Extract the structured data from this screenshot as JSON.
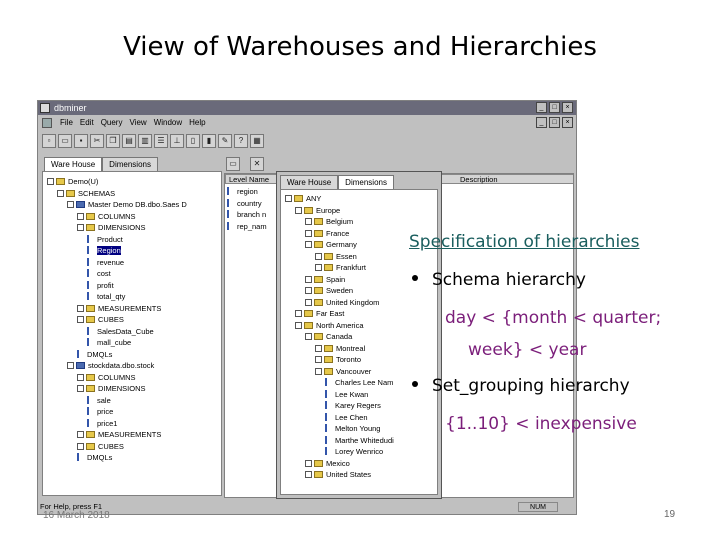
{
  "slide": {
    "title": "View of Warehouses and Hierarchies",
    "date": "16 March 2018",
    "page_number": "19"
  },
  "app": {
    "title": "dbminer",
    "menus": [
      "File",
      "Edit",
      "Query",
      "View",
      "Window",
      "Help"
    ],
    "status": "For Help, press F1",
    "num_indicator": "NUM"
  },
  "left_panel": {
    "tabs": [
      "Ware House",
      "Dimensions"
    ],
    "tree": [
      {
        "label": "Demo(U)",
        "kind": "folder",
        "level": 0
      },
      {
        "label": "SCHEMAS",
        "kind": "folder",
        "level": 1
      },
      {
        "label": "Master Demo DB.dbo.Saes D",
        "kind": "dim",
        "level": 2
      },
      {
        "label": "COLUMNS",
        "kind": "folder",
        "level": 3
      },
      {
        "label": "DIMENSIONS",
        "kind": "folder",
        "level": 3
      },
      {
        "label": "Product",
        "kind": "item",
        "level": 4
      },
      {
        "label": "Region",
        "kind": "item",
        "level": 4,
        "selected": true
      },
      {
        "label": "revenue",
        "kind": "item",
        "level": 4
      },
      {
        "label": "cost",
        "kind": "item",
        "level": 4
      },
      {
        "label": "profit",
        "kind": "item",
        "level": 4
      },
      {
        "label": "total_qty",
        "kind": "item",
        "level": 4
      },
      {
        "label": "MEASUREMENTS",
        "kind": "folder",
        "level": 3
      },
      {
        "label": "CUBES",
        "kind": "folder",
        "level": 3
      },
      {
        "label": "SalesData_Cube",
        "kind": "item",
        "level": 4
      },
      {
        "label": "mall_cube",
        "kind": "item",
        "level": 4
      },
      {
        "label": "DMQLs",
        "kind": "item",
        "level": 3
      },
      {
        "label": "stockdata.dbo.stock",
        "kind": "dim",
        "level": 2
      },
      {
        "label": "COLUMNS",
        "kind": "folder",
        "level": 3
      },
      {
        "label": "DIMENSIONS",
        "kind": "folder",
        "level": 3
      },
      {
        "label": "sale",
        "kind": "item",
        "level": 4
      },
      {
        "label": "price",
        "kind": "item",
        "level": 4
      },
      {
        "label": "price1",
        "kind": "item",
        "level": 4
      },
      {
        "label": "MEASUREMENTS",
        "kind": "folder",
        "level": 3
      },
      {
        "label": "CUBES",
        "kind": "folder",
        "level": 3
      },
      {
        "label": "DMQLs",
        "kind": "item",
        "level": 3
      }
    ]
  },
  "list_panel": {
    "columns": [
      "Level Name",
      "Description"
    ],
    "rows": [
      "region",
      "country",
      "branch n",
      "rep_nam"
    ]
  },
  "right_panel": {
    "tabs": [
      "Ware House",
      "Dimensions"
    ],
    "tree": [
      {
        "label": "ANY",
        "kind": "folder",
        "level": 0
      },
      {
        "label": "Europe",
        "kind": "folder",
        "level": 1
      },
      {
        "label": "Belgium",
        "kind": "folder",
        "level": 2
      },
      {
        "label": "France",
        "kind": "folder",
        "level": 2
      },
      {
        "label": "Germany",
        "kind": "folder",
        "level": 2
      },
      {
        "label": "Essen",
        "kind": "folder",
        "level": 3
      },
      {
        "label": "Frankfurt",
        "kind": "folder",
        "level": 3
      },
      {
        "label": "Spain",
        "kind": "folder",
        "level": 2
      },
      {
        "label": "Sweden",
        "kind": "folder",
        "level": 2
      },
      {
        "label": "United Kingdom",
        "kind": "folder",
        "level": 2
      },
      {
        "label": "Far East",
        "kind": "folder",
        "level": 1
      },
      {
        "label": "North America",
        "kind": "folder",
        "level": 1
      },
      {
        "label": "Canada",
        "kind": "folder",
        "level": 2
      },
      {
        "label": "Montreal",
        "kind": "folder",
        "level": 3
      },
      {
        "label": "Toronto",
        "kind": "folder",
        "level": 3
      },
      {
        "label": "Vancouver",
        "kind": "folder",
        "level": 3
      },
      {
        "label": "Charles Lee Nam",
        "kind": "item",
        "level": 4
      },
      {
        "label": "Lee Kwan",
        "kind": "item",
        "level": 4
      },
      {
        "label": "Karey Regers",
        "kind": "item",
        "level": 4
      },
      {
        "label": "Lee Chen",
        "kind": "item",
        "level": 4
      },
      {
        "label": "Melton Young",
        "kind": "item",
        "level": 4
      },
      {
        "label": "Marthe Whitedudi",
        "kind": "item",
        "level": 4
      },
      {
        "label": "Lorey Wenrico",
        "kind": "item",
        "level": 4
      },
      {
        "label": "Mexico",
        "kind": "folder",
        "level": 2
      },
      {
        "label": "United States",
        "kind": "folder",
        "level": 2
      }
    ]
  },
  "overlay": {
    "heading": "Specification of hierarchies",
    "bullet1": "Schema hierarchy",
    "sub1_line1": "day < {month < quarter;",
    "sub1_line2": "week} < year",
    "bullet2": "Set_grouping hierarchy",
    "sub2": "{1..10} < inexpensive"
  }
}
